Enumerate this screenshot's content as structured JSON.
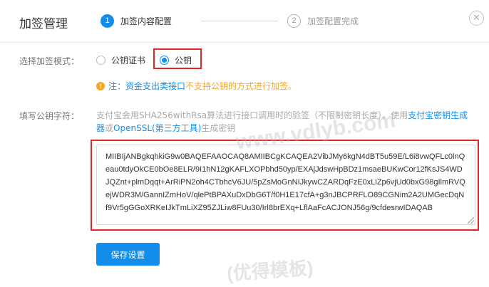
{
  "header": {
    "title": "加签管理",
    "steps": [
      {
        "num": "1",
        "label": "加签内容配置"
      },
      {
        "num": "2",
        "label": "加签配置完成"
      }
    ],
    "close_symbol": "✕"
  },
  "form": {
    "mode_label": "选择加签模式：",
    "options": [
      {
        "label": "公钥证书",
        "checked": false
      },
      {
        "label": "公钥",
        "checked": true
      }
    ],
    "notice": {
      "icon": "!",
      "part1": "注：资金支出类接口",
      "part2": "不支持公钥的方式进行加签。"
    },
    "key_label": "填写公钥字符：",
    "hint": {
      "text1": "支付宝会用SHA256withRsa算法进行接口调用时的验签（不限制密钥长度）。使用",
      "link1": "支付宝密钥生成器",
      "text2": "或",
      "link2": "OpenSSL(第三方工具)",
      "text3": "生成密钥"
    },
    "key_value": "MIIBIjANBgkqhkiG9w0BAQEFAAOCAQ8AMIIBCgKCAQEA2VibJMy6kgN4dBT5u59E/L6i8vwQFLc0lnQeau0tdyOkCE0bOe8ELR/9I1hN12gKAFLXOPbhd50yp/EXAjJdswHpBDz1msaeBUKwCor12fKsJS4WDJQZnt+plmDqqt+ArRiPN2oh4CTbhcV6JU/5pZsMoGnNIJkywCZARDqFzE0xLiZp6vjUd0bxG98gIlmRVQejWDR3M/GannIZmHoV/qlePtBPAXuDxDbG6T/f0H1E17cfA+g3nJBCPRFLO89CGNim2A2UMGecDqNf9Vr5gGGoXRKeIJkTmLiXZ95ZJLiw8FUu30/Irl8brEXq+LflAaFcACJONJ56g/9cfdesrwIDAQAB",
    "save_label": "保存设置"
  },
  "watermark": {
    "text1": "www.vdlyb.com",
    "text2": "(优得模板)"
  },
  "colors": {
    "primary": "#108ee9",
    "warning": "#f5a623",
    "highlight": "#e0282b"
  }
}
